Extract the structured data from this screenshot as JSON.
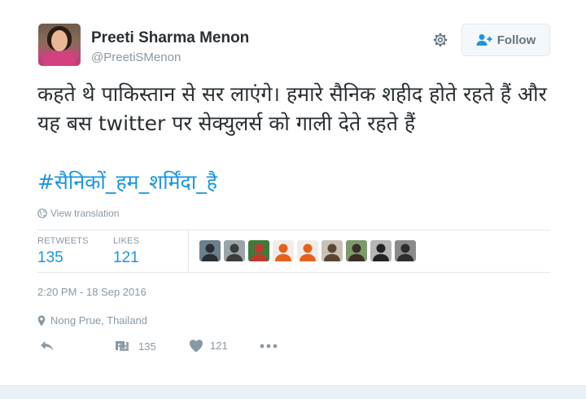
{
  "user": {
    "name": "Preeti Sharma Menon",
    "handle": "@PreetiSMenon"
  },
  "follow_button": {
    "label": "Follow"
  },
  "tweet": {
    "text": "कहते थे पाकिस्तान से सर लाएंगे। हमारे सैनिक शहीद होते रहते हैं और यह बस twitter पर सेक्युलर्स को गाली देते रहते हैं",
    "hashtag": "#सैनिकों_हम_शर्मिंदा_है",
    "view_translation": "View translation"
  },
  "stats": {
    "retweets_label": "RETWEETS",
    "retweets": "135",
    "likes_label": "LIKES",
    "likes": "121"
  },
  "likers": [
    {
      "name": "liker-1",
      "bg": "#6b7f8c",
      "fg": "#2a2f33"
    },
    {
      "name": "liker-2",
      "bg": "#9aa4aa",
      "fg": "#3c3c3c"
    },
    {
      "name": "liker-3",
      "bg": "#3f7a3c",
      "fg": "#c0392b"
    },
    {
      "name": "liker-4",
      "bg": "#f0ede9",
      "fg": "#e8601c"
    },
    {
      "name": "liker-5",
      "bg": "#f0ede9",
      "fg": "#e8601c"
    },
    {
      "name": "liker-6",
      "bg": "#c9c1b5",
      "fg": "#5a4535"
    },
    {
      "name": "liker-7",
      "bg": "#7c9a6a",
      "fg": "#3b2f28"
    },
    {
      "name": "liker-8",
      "bg": "#b5b5b5",
      "fg": "#222222"
    },
    {
      "name": "liker-9",
      "bg": "#8a8a8a",
      "fg": "#2d2d2d"
    }
  ],
  "timestamp": "2:20 PM - 18 Sep 2016",
  "location": "Nong Prue, Thailand",
  "actions": {
    "retweet_count": "135",
    "like_count": "121"
  },
  "colors": {
    "accent": "#1b95e0",
    "muted": "#8899a6",
    "text": "#292f33"
  }
}
